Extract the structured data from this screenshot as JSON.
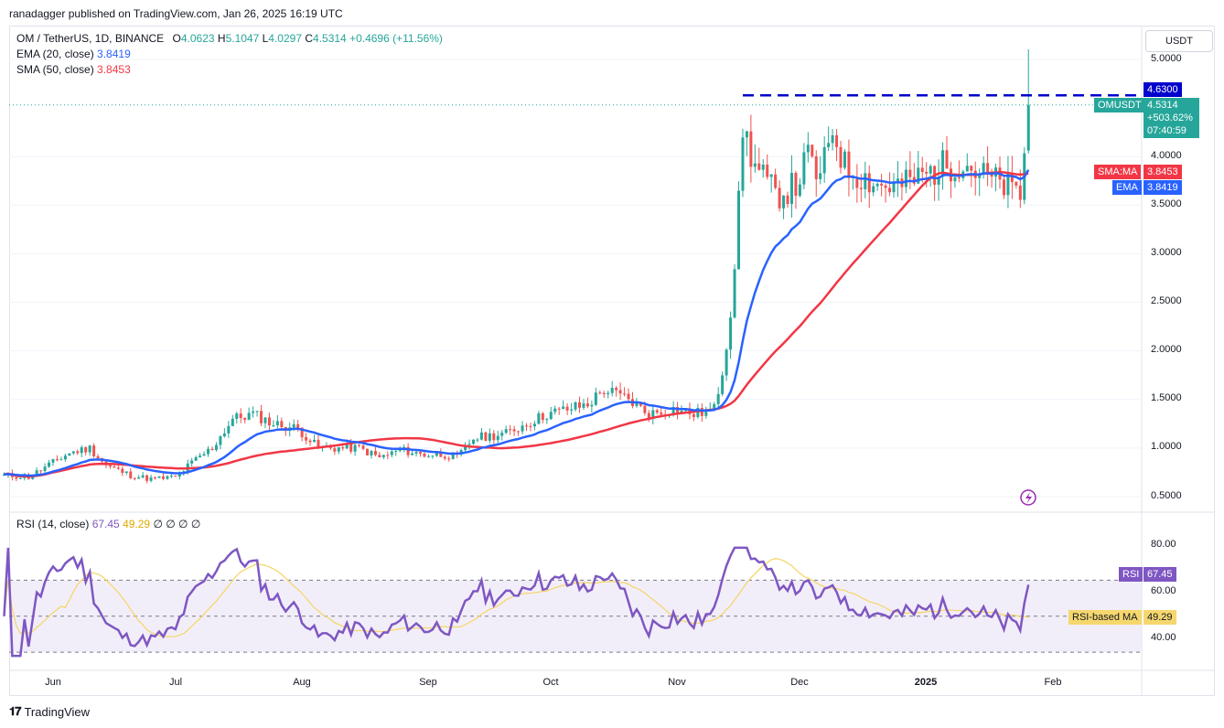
{
  "header": {
    "published_line": "ranadagger published on TradingView.com, Jan 26, 2025 16:19 UTC"
  },
  "legend": {
    "symbol": "OM / TetherUS, 1D, BINANCE",
    "open_label": "O",
    "open": "4.0623",
    "high_label": "H",
    "high": "5.1047",
    "low_label": "L",
    "low": "4.0297",
    "close_label": "C",
    "close": "4.5314",
    "change": "+0.4696 (+11.56%)",
    "ema_label": "EMA (20, close)",
    "ema_value": "3.8419",
    "sma_label": "SMA (50, close)",
    "sma_value": "3.8453",
    "rsi_label": "RSI (14, close)",
    "rsi_value": "67.45",
    "rsi_ma_value": "49.29",
    "rsi_extra": "∅ ∅ ∅ ∅"
  },
  "currency_selector": "USDT",
  "price_tags": {
    "level_price": "4.6300",
    "symbol_name": "OMUSDT",
    "last_price": "4.5314",
    "last_change": "+503.62%",
    "countdown": "07:40:59",
    "sma_tag_label": "SMA:MA",
    "sma_tag_value": "3.8453",
    "ema_tag_label": "EMA",
    "ema_tag_value": "3.8419",
    "rsi_tag_label": "RSI",
    "rsi_tag_value": "67.45",
    "rsi_ma_tag_label": "RSI-based MA",
    "rsi_ma_tag_value": "49.29"
  },
  "colors": {
    "up": "#26a69a",
    "down": "#ef5350",
    "ema": "#2962ff",
    "sma": "#f23645",
    "rsi": "#7e57c2",
    "rsi_ma": "#f5d76e",
    "level": "#0000cc"
  },
  "brand": {
    "name": "TradingView"
  },
  "chart_data": [
    {
      "type": "candlestick",
      "x_ticks": [
        "Jun",
        "Jul",
        "Aug",
        "Sep",
        "Oct",
        "Nov",
        "Dec",
        "2025",
        "Feb"
      ],
      "y_ticks": [
        "5.0000",
        "4.0000",
        "3.5000",
        "3.0000",
        "2.5000",
        "2.0000",
        "1.5000",
        "1.0000",
        "0.5000"
      ],
      "ylim": [
        0.5,
        5.0
      ],
      "resistance_level": 4.63,
      "close_anchors": [
        [
          "2024-05-20",
          0.72
        ],
        [
          "2024-05-26",
          0.7
        ],
        [
          "2024-06-01",
          0.85
        ],
        [
          "2024-06-05",
          0.95
        ],
        [
          "2024-06-10",
          1.0
        ],
        [
          "2024-06-14",
          0.82
        ],
        [
          "2024-06-20",
          0.72
        ],
        [
          "2024-06-25",
          0.68
        ],
        [
          "2024-07-01",
          0.7
        ],
        [
          "2024-07-05",
          0.85
        ],
        [
          "2024-07-10",
          1.0
        ],
        [
          "2024-07-15",
          1.3
        ],
        [
          "2024-07-20",
          1.35
        ],
        [
          "2024-07-25",
          1.25
        ],
        [
          "2024-07-31",
          1.2
        ],
        [
          "2024-08-05",
          1.0
        ],
        [
          "2024-08-10",
          1.0
        ],
        [
          "2024-08-15",
          1.0
        ],
        [
          "2024-08-20",
          0.9
        ],
        [
          "2024-08-25",
          0.98
        ],
        [
          "2024-08-31",
          0.93
        ],
        [
          "2024-09-05",
          0.93
        ],
        [
          "2024-09-08",
          0.9
        ],
        [
          "2024-09-12",
          1.1
        ],
        [
          "2024-09-20",
          1.15
        ],
        [
          "2024-09-30",
          1.35
        ],
        [
          "2024-10-10",
          1.45
        ],
        [
          "2024-10-14",
          1.6
        ],
        [
          "2024-10-20",
          1.5
        ],
        [
          "2024-10-25",
          1.35
        ],
        [
          "2024-10-31",
          1.4
        ],
        [
          "2024-11-05",
          1.35
        ],
        [
          "2024-11-10",
          1.4
        ],
        [
          "2024-11-12",
          1.8
        ],
        [
          "2024-11-14",
          2.4
        ],
        [
          "2024-11-16",
          3.5
        ],
        [
          "2024-11-17",
          4.3
        ],
        [
          "2024-11-20",
          3.9
        ],
        [
          "2024-11-25",
          3.6
        ],
        [
          "2024-11-30",
          3.7
        ],
        [
          "2024-12-03",
          4.0
        ],
        [
          "2024-12-06",
          3.75
        ],
        [
          "2024-12-09",
          4.3
        ],
        [
          "2024-12-12",
          3.9
        ],
        [
          "2024-12-16",
          3.8
        ],
        [
          "2024-12-21",
          3.7
        ],
        [
          "2024-12-26",
          3.7
        ],
        [
          "2024-12-31",
          3.8
        ],
        [
          "2025-01-05",
          3.9
        ],
        [
          "2025-01-10",
          3.95
        ],
        [
          "2025-01-15",
          3.8
        ],
        [
          "2025-01-20",
          3.7
        ],
        [
          "2025-01-24",
          3.6
        ],
        [
          "2025-01-25",
          4.06
        ],
        [
          "2025-01-26",
          4.53
        ]
      ],
      "last_candle": {
        "open": 4.0623,
        "high": 5.1047,
        "low": 4.0297,
        "close": 4.5314
      },
      "ema20_last": 3.8419,
      "sma50_last": 3.8453
    },
    {
      "type": "line",
      "name": "RSI (14, close)",
      "y_ticks": [
        "80.00",
        "60.00",
        "40.00"
      ],
      "bands": [
        70,
        50,
        30
      ],
      "rsi_last": 67.45,
      "rsi_ma_last": 49.29
    }
  ]
}
